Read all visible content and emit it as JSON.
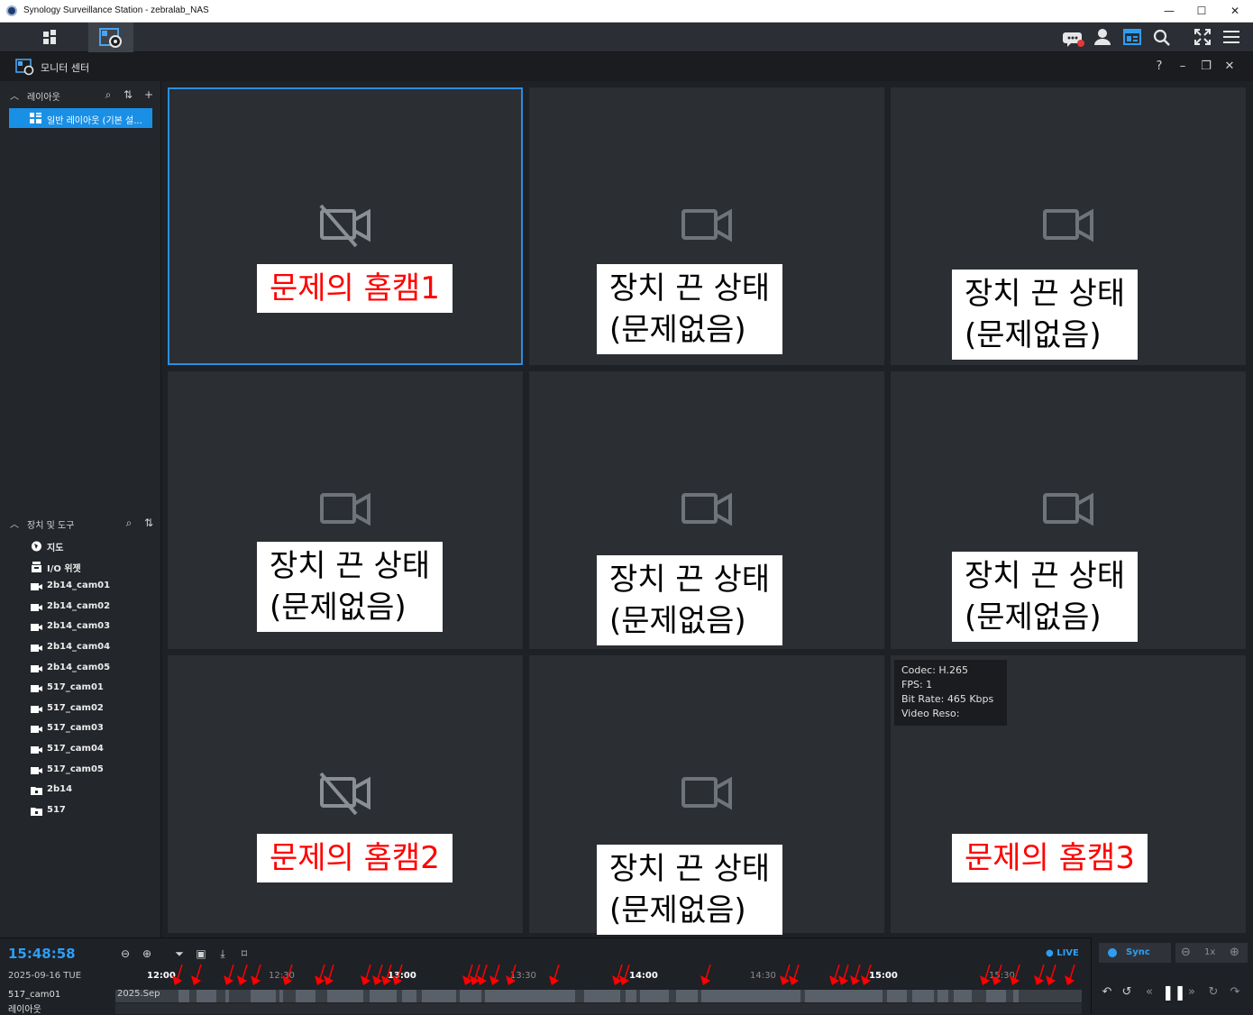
{
  "window": {
    "title": "Synology Surveillance Station - zebralab_NAS",
    "minimize": "—",
    "maximize": "☐",
    "close": "✕"
  },
  "monitor_center": {
    "title": "모니터 센터",
    "help": "?",
    "minimize": "–",
    "restore": "❐",
    "close": "✕"
  },
  "sidebar": {
    "layout_section": {
      "label": "레이아웃",
      "item": "일반 레이아웃 (기본 설..."
    },
    "device_section": {
      "label": "장치 및 도구",
      "items": [
        {
          "label": "지도",
          "icon": "map-icon"
        },
        {
          "label": "I/O 위젯",
          "icon": "io-widget-icon"
        },
        {
          "label": "2b14_cam01",
          "icon": "camera-icon"
        },
        {
          "label": "2b14_cam02",
          "icon": "camera-icon"
        },
        {
          "label": "2b14_cam03",
          "icon": "camera-icon"
        },
        {
          "label": "2b14_cam04",
          "icon": "camera-icon"
        },
        {
          "label": "2b14_cam05",
          "icon": "camera-icon"
        },
        {
          "label": "517_cam01",
          "icon": "camera-icon"
        },
        {
          "label": "517_cam02",
          "icon": "camera-icon"
        },
        {
          "label": "517_cam03",
          "icon": "camera-icon"
        },
        {
          "label": "517_cam04",
          "icon": "camera-icon"
        },
        {
          "label": "517_cam05",
          "icon": "camera-icon"
        },
        {
          "label": "2b14",
          "icon": "folder-icon"
        },
        {
          "label": "517",
          "icon": "folder-icon"
        }
      ]
    }
  },
  "tiles": [
    {
      "icon": "camera-off-icon",
      "label": [
        "문제의 홈캠1"
      ],
      "red": true
    },
    {
      "icon": "camera-icon",
      "label": [
        "장치 끈 상태",
        "(문제없음)"
      ],
      "red": false
    },
    {
      "icon": "camera-icon",
      "label": [
        "장치 끈 상태",
        "(문제없음)"
      ],
      "red": false
    },
    {
      "icon": "camera-icon",
      "label": [
        "장치 끈 상태",
        "(문제없음)"
      ],
      "red": false
    },
    {
      "icon": "camera-icon",
      "label": [
        "장치 끈 상태",
        "(문제없음)"
      ],
      "red": false
    },
    {
      "icon": "camera-icon",
      "label": [
        "장치 끈 상태",
        "(문제없음)"
      ],
      "red": false
    },
    {
      "icon": "camera-off-icon",
      "label": [
        "문제의 홈캠2"
      ],
      "red": true
    },
    {
      "icon": "camera-icon",
      "label": [
        "장치 끈 상태",
        "(문제없음)"
      ],
      "red": false
    },
    {
      "icon": "none",
      "label": [
        "문제의 홈캠3"
      ],
      "red": true
    }
  ],
  "codec_info": {
    "codec": "Codec: H.265",
    "fps": "FPS: 1",
    "bitrate": "Bit Rate: 465 Kbps",
    "reso": "Video Reso:"
  },
  "timeline": {
    "clock": "15:48:58",
    "date": "2025-09-16 TUE",
    "camera": "517_cam01",
    "layout": "레이아웃",
    "live": "● LIVE",
    "track_date": "2025.Sep",
    "ticks": [
      {
        "label": "12:00",
        "major": true
      },
      {
        "label": "12:30",
        "major": false
      },
      {
        "label": "13:00",
        "major": true
      },
      {
        "label": "13:30",
        "major": false
      },
      {
        "label": "14:00",
        "major": true
      },
      {
        "label": "14:30",
        "major": false
      },
      {
        "label": "15:00",
        "major": true
      },
      {
        "label": "15:30",
        "major": false
      }
    ],
    "sync": "Sync",
    "speed": "1x"
  },
  "colors": {
    "accent": "#2e9ef4",
    "selected_tile": "#2b8ee0",
    "label_red": "#ff0000",
    "marker": "#ff0000"
  }
}
